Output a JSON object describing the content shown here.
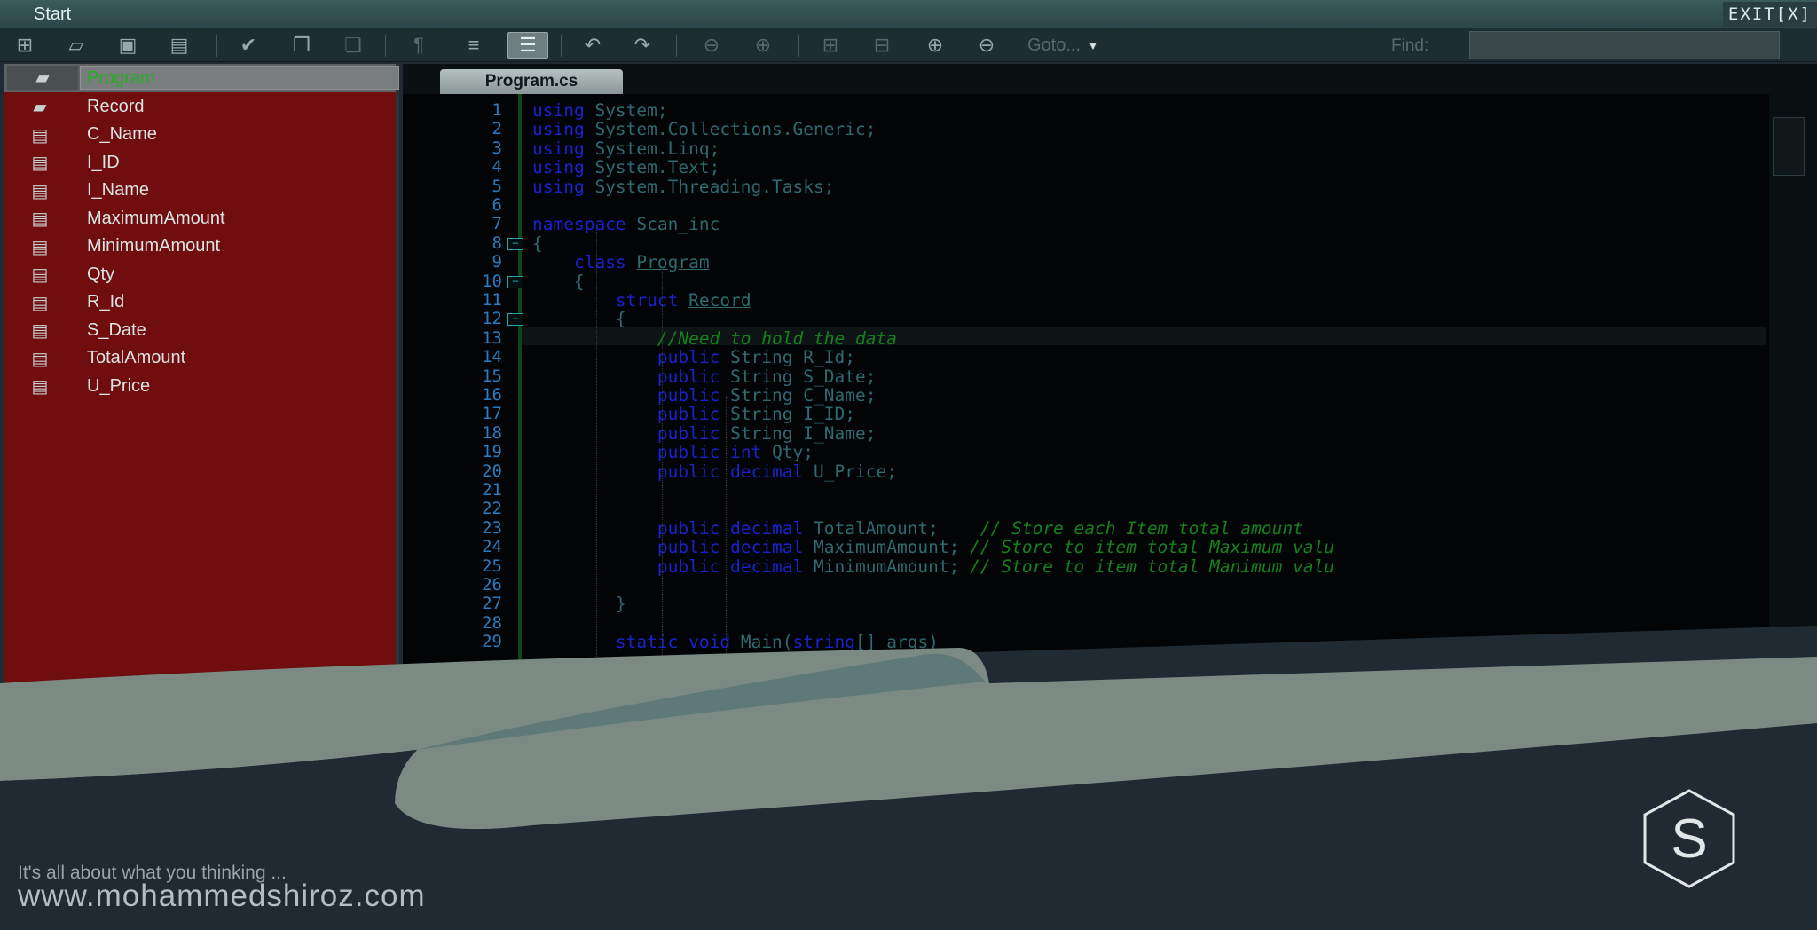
{
  "window": {
    "title": "Start",
    "exit_label": "EXIT[X]"
  },
  "toolbar": {
    "goto_label": "Goto...",
    "find_label": "Find:",
    "find_value": ""
  },
  "sidebar": {
    "items": [
      {
        "label": "Program",
        "icon": "class-icon"
      },
      {
        "label": "Record",
        "icon": "struct-icon"
      },
      {
        "label": "C_Name",
        "icon": "field-icon"
      },
      {
        "label": "I_ID",
        "icon": "field-icon"
      },
      {
        "label": "I_Name",
        "icon": "field-icon"
      },
      {
        "label": "MaximumAmount",
        "icon": "field-icon"
      },
      {
        "label": "MinimumAmount",
        "icon": "field-icon"
      },
      {
        "label": "Qty",
        "icon": "field-icon"
      },
      {
        "label": "R_Id",
        "icon": "field-icon"
      },
      {
        "label": "S_Date",
        "icon": "field-icon"
      },
      {
        "label": "TotalAmount",
        "icon": "field-icon"
      },
      {
        "label": "U_Price",
        "icon": "field-icon"
      }
    ]
  },
  "editor": {
    "tab_label": "Program.cs",
    "lines": [
      {
        "n": "1",
        "text": "using System;"
      },
      {
        "n": "2",
        "text": "using System.Collections.Generic;"
      },
      {
        "n": "3",
        "text": "using System.Linq;"
      },
      {
        "n": "4",
        "text": "using System.Text;"
      },
      {
        "n": "5",
        "text": "using System.Threading.Tasks;"
      },
      {
        "n": "6",
        "text": ""
      },
      {
        "n": "7",
        "text": "namespace Scan_inc"
      },
      {
        "n": "8",
        "text": "{"
      },
      {
        "n": "9",
        "text": "    class Program"
      },
      {
        "n": "10",
        "text": "    {"
      },
      {
        "n": "11",
        "text": "        struct Record"
      },
      {
        "n": "12",
        "text": "        {"
      },
      {
        "n": "13",
        "text": "            //Need to hold the data"
      },
      {
        "n": "14",
        "text": "            public String R_Id;"
      },
      {
        "n": "15",
        "text": "            public String S_Date;"
      },
      {
        "n": "16",
        "text": "            public String C_Name;"
      },
      {
        "n": "17",
        "text": "            public String I_ID;"
      },
      {
        "n": "18",
        "text": "            public String I_Name;"
      },
      {
        "n": "19",
        "text": "            public int Qty;"
      },
      {
        "n": "20",
        "text": "            public decimal U_Price;"
      },
      {
        "n": "21",
        "text": ""
      },
      {
        "n": "22",
        "text": ""
      },
      {
        "n": "23",
        "text": "            public decimal TotalAmount;    // Store each Item total amount"
      },
      {
        "n": "24",
        "text": "            public decimal MaximumAmount; // Store to item total Maximum valu"
      },
      {
        "n": "25",
        "text": "            public decimal MinimumAmount; // Store to item total Manimum valu"
      },
      {
        "n": "26",
        "text": ""
      },
      {
        "n": "27",
        "text": "        }"
      },
      {
        "n": "28",
        "text": ""
      },
      {
        "n": "29",
        "text": "        static void Main(string[] args)"
      }
    ]
  },
  "branding": {
    "tagline": "It's all about what you thinking ...",
    "website": "www.mohammedshiroz.com",
    "logo_letter": "S"
  },
  "colors": {
    "keyword": "#1a22d0",
    "comment": "#16801c",
    "identifier": "#2e6a72",
    "line_number": "#2a7cc0",
    "sidebar_bg": "#6f0d0f",
    "selected_text": "#1fb01b"
  }
}
